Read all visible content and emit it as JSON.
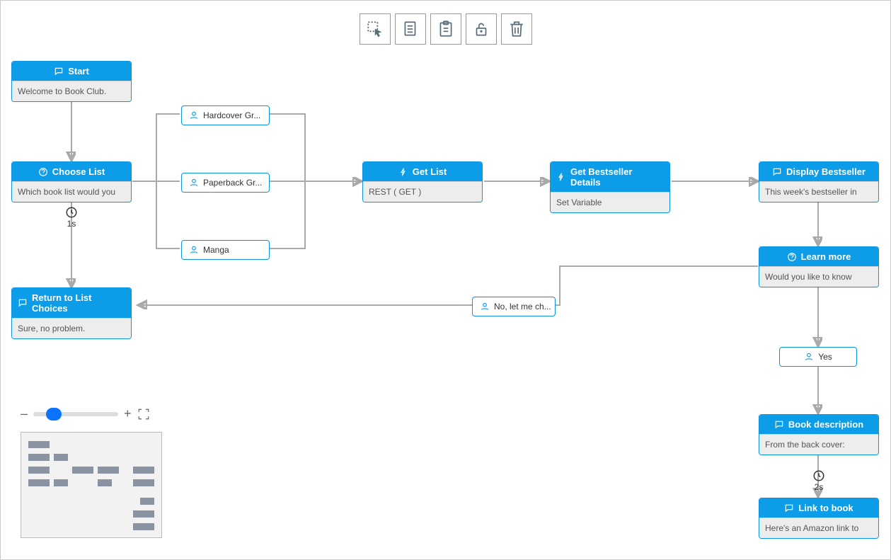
{
  "toolbar": {
    "icons": [
      "select-icon",
      "copy-icon",
      "paste-icon",
      "unlock-icon",
      "delete-icon"
    ]
  },
  "nodes": {
    "start": {
      "title": "Start",
      "body": "Welcome to Book Club."
    },
    "choose_list": {
      "title": "Choose List",
      "body": "Which book list would you"
    },
    "return_list": {
      "title": "Return to List Choices",
      "body": "Sure, no problem."
    },
    "get_list": {
      "title": "Get List",
      "body": "REST ( GET )"
    },
    "get_details": {
      "title": "Get Bestseller Details",
      "body": "Set Variable"
    },
    "display_bestseller": {
      "title": "Display Bestseller",
      "body": "This week's bestseller in"
    },
    "learn_more": {
      "title": "Learn more",
      "body": "Would you like to know"
    },
    "book_description": {
      "title": "Book description",
      "body": "From the back cover:"
    },
    "link_to_book": {
      "title": "Link to book",
      "body": "Here's an Amazon link to"
    }
  },
  "choices": {
    "hardcover": "Hardcover Gr...",
    "paperback": "Paperback Gr...",
    "manga": "Manga",
    "no_let_me": "No, let me ch...",
    "yes": "Yes"
  },
  "delays": {
    "d1": "1s",
    "d2": "2s"
  },
  "zoom": {
    "minus": "–",
    "plus": "+"
  }
}
